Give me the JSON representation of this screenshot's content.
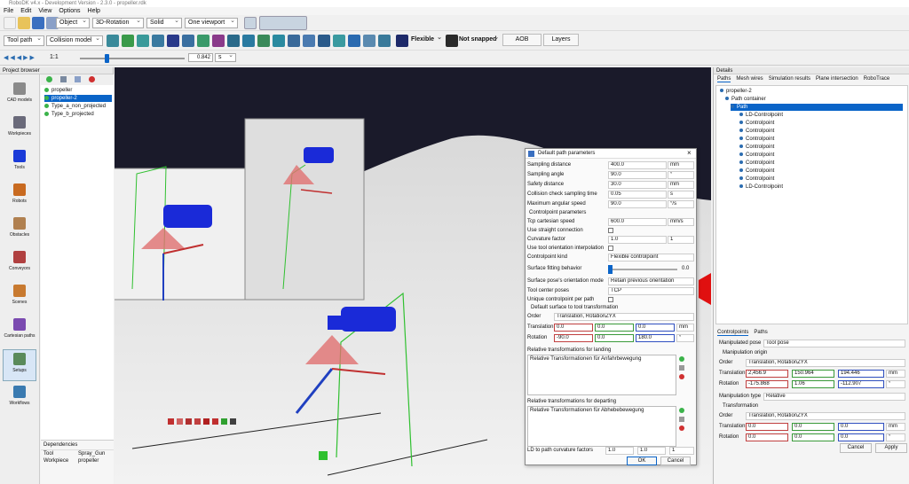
{
  "window": {
    "title": "RoboDK v4.x - Development Version - 2.3.0 - propeller.rdk"
  },
  "menu": [
    "File",
    "Edit",
    "View",
    "Options",
    "Help"
  ],
  "toolbar1": {
    "mode": "Object",
    "rotation": "3D-Rotation",
    "render": "Solid",
    "viewport": "One viewport"
  },
  "toolbar2": {
    "tool_path": "Tool path",
    "collision": "Collision model",
    "flexible": "Flexible",
    "snap": "Not snapped",
    "aob": "AOB",
    "layers": "Layers"
  },
  "toolbar3": {
    "ratio": "1:1",
    "slider_value": "0.842",
    "unit": "s",
    "slider_fraction": 0.25
  },
  "project_browser": {
    "title": "Project browser",
    "side_items": [
      "CAD models",
      "Workpieces",
      "Tools",
      "Robots",
      "Obstacles",
      "Conveyors",
      "Scenes",
      "Cartesian paths",
      "Setups",
      "Workflows"
    ],
    "tree": [
      "propeller",
      "propeller-2",
      "Type_a_non_projected",
      "Type_b_projected"
    ],
    "dependencies_title": "Dependencies",
    "dependencies": [
      {
        "k": "Tool",
        "v": "Spray_Gun"
      },
      {
        "k": "Workpiece",
        "v": "propeller"
      }
    ]
  },
  "dialog": {
    "title": "Default path parameters",
    "rows": [
      {
        "label": "Sampling distance",
        "value": "400.0",
        "unit": "mm"
      },
      {
        "label": "Sampling angle",
        "value": "90.0",
        "unit": "°"
      },
      {
        "label": "Safety distance",
        "value": "30.0",
        "unit": "mm"
      },
      {
        "label": "Collision check sampling time",
        "value": "0.05",
        "unit": "s"
      },
      {
        "label": "Maximum angular speed",
        "value": "90.0",
        "unit": "°/s"
      }
    ],
    "cp_params_title": "Controlpoint parameters",
    "tcp_speed_label": "Tcp cartesian speed",
    "tcp_speed": "600.0",
    "tcp_speed_unit": "mm/s",
    "straight_label": "Use straight connection",
    "curvature_label": "Curvature factor",
    "curvature": "1.0",
    "curvature_unit": "1",
    "tool_orient_label": "Use tool orientation interpolation",
    "cp_kind_label": "Controlpoint kind",
    "cp_kind": "Flexible controlpoint",
    "surface_fit_label": "Surface fitting behavior",
    "surface_fit": "0.0",
    "surface_fit_fraction": 0.0,
    "orient_mode_label": "Surface pose's orientation mode",
    "orient_mode": "Retain previous orientation",
    "tcp_poses_label": "Tool center poses",
    "tcp_poses": "TCP",
    "unique_label": "Unique controlpoint per path",
    "transform_title": "Default surface to tool transformation",
    "order_label": "Order",
    "order": "Translation, RotationZYX",
    "translation_label": "Translation",
    "translation": [
      "0.0",
      "0.0",
      "0.0"
    ],
    "translation_unit": "mm",
    "rotation_label": "Rotation",
    "rotation": [
      "-90.0",
      "0.0",
      "180.0"
    ],
    "rotation_unit": "°",
    "landing_title": "Relative transformations for landing",
    "landing_item": "Relative Transformationen für Anfahrbewegung",
    "departing_title": "Relative transformations for departing",
    "departing_item": "Relative Transformationen für Abhebebewegung",
    "ld_label": "LD to path curvature factors",
    "ld_values": [
      "1.0",
      "1.0",
      "1"
    ],
    "ok": "OK",
    "cancel": "Cancel"
  },
  "details": {
    "title": "Details",
    "tabs": [
      "Paths",
      "Mesh wires",
      "Simulation results",
      "Plane intersection",
      "RoboTrace"
    ],
    "tree": [
      "propeller-2",
      "Path container",
      "Path",
      "LD-Controlpoint",
      "Controlpoint",
      "Controlpoint",
      "Controlpoint",
      "Controlpoint",
      "Controlpoint",
      "Controlpoint",
      "Controlpoint",
      "Controlpoint",
      "LD-Controlpoint"
    ],
    "lower_tabs": [
      "Controlpoints",
      "Paths"
    ],
    "manip_pose_label": "Manipulated pose",
    "manip_pose": "Tool pose",
    "manip_origin_title": "Manipulation origin",
    "order_label": "Order",
    "order": "Translation, RotationZYX",
    "translation_label": "Translation",
    "translation": [
      "2,456.9",
      "150.964",
      "194.446"
    ],
    "translation_unit": "mm",
    "rotation_label": "Rotation",
    "rotation": [
      "-175.868",
      "1.06",
      "-112.907"
    ],
    "rotation_unit": "°",
    "manip_type_label": "Manipulation type",
    "manip_type": "Relative",
    "transform_title": "Transformation",
    "t_order": "Translation, RotationZYX",
    "t_translation": [
      "0.0",
      "0.0",
      "0.0"
    ],
    "t_rotation": [
      "0.0",
      "0.0",
      "0.0"
    ],
    "cancel": "Cancel",
    "apply": "Apply"
  },
  "colors": {
    "accent": "#0a64c8",
    "x_axis": "#c04040",
    "y_axis": "#3a9a3a",
    "z_axis": "#3050c0"
  }
}
